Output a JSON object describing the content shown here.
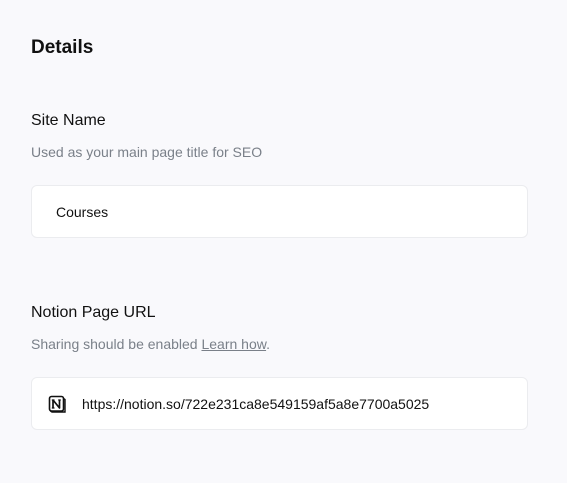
{
  "details": {
    "title": "Details"
  },
  "site_name": {
    "label": "Site Name",
    "help": "Used as your main page title for SEO",
    "value": "Courses"
  },
  "notion_page_url": {
    "label": "Notion Page URL",
    "help_prefix": "Sharing should be enabled ",
    "help_link": "Learn how",
    "help_suffix": ".",
    "value": "https://notion.so/722e231ca8e549159af5a8e7700a5025",
    "icon": "notion-logo-icon"
  }
}
